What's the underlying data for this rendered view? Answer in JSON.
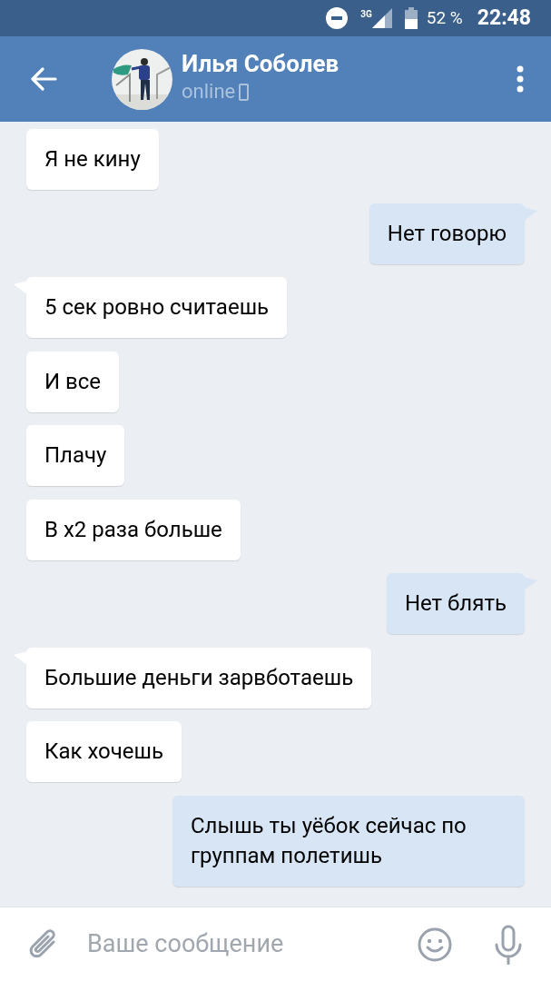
{
  "status_bar": {
    "battery": "52 %",
    "time": "22:48",
    "network": "3G"
  },
  "header": {
    "name": "Илья Соболев",
    "status": "online"
  },
  "messages": [
    {
      "text": "Я не кину",
      "outgoing": false,
      "tail": false
    },
    {
      "text": "Нет говорю",
      "outgoing": true,
      "tail": true
    },
    {
      "text": "5 сек ровно считаешь",
      "outgoing": false,
      "tail": true
    },
    {
      "text": "И все",
      "outgoing": false,
      "tail": false
    },
    {
      "text": "Плачу",
      "outgoing": false,
      "tail": false
    },
    {
      "text": "В x2 раза больше",
      "outgoing": false,
      "tail": false
    },
    {
      "text": "Нет блять",
      "outgoing": true,
      "tail": true
    },
    {
      "text": "Большие деньги зарвботаешь",
      "outgoing": false,
      "tail": true
    },
    {
      "text": "Как хочешь",
      "outgoing": false,
      "tail": false
    },
    {
      "text": "Слышь ты уёбок сейчас по группам полетишь",
      "outgoing": true,
      "tail": false
    }
  ],
  "composer": {
    "placeholder": "Ваше сообщение"
  }
}
